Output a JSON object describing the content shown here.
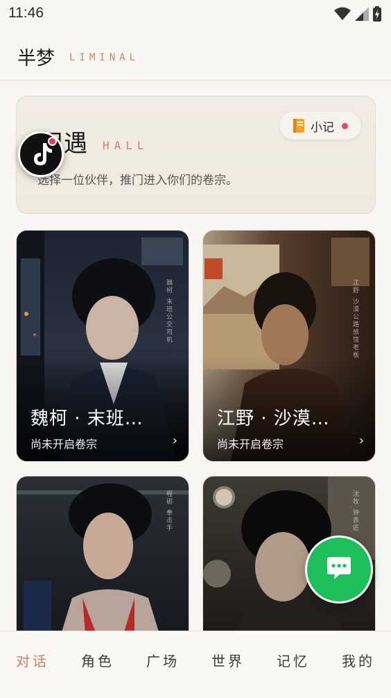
{
  "status_bar": {
    "time": "11:46"
  },
  "header": {
    "app_name": "半梦",
    "app_subtitle": "LIMINAL"
  },
  "hall": {
    "title": "相遇",
    "title_en": "HALL",
    "description": "选择一位伙伴，推门进入你们的卷宗。",
    "note_button": {
      "icon": "notebook-icon",
      "label": "小记"
    }
  },
  "cards": [
    {
      "name": "魏柯 · 末班…",
      "status": "尚未开启卷宗",
      "side_text": "魏柯 末班公交司机"
    },
    {
      "name": "江野 · 沙漠…",
      "status": "尚未开启卷宗",
      "side_text": "江野 沙漠公路旅馆老板"
    },
    {
      "name": "",
      "status": "",
      "side_text": "程砺 拳击手"
    },
    {
      "name": "",
      "status": "",
      "side_text": "沈牧 钟表匠"
    }
  ],
  "bottom_nav": {
    "tabs": [
      {
        "label": "对话",
        "active": true
      },
      {
        "label": "角色",
        "active": false
      },
      {
        "label": "广场",
        "active": false
      },
      {
        "label": "世界",
        "active": false
      },
      {
        "label": "记忆",
        "active": false
      },
      {
        "label": "我的",
        "active": false
      }
    ]
  },
  "colors": {
    "accent": "#c9836a",
    "fab": "#1dbf5a",
    "badge": "#e14a6a"
  }
}
